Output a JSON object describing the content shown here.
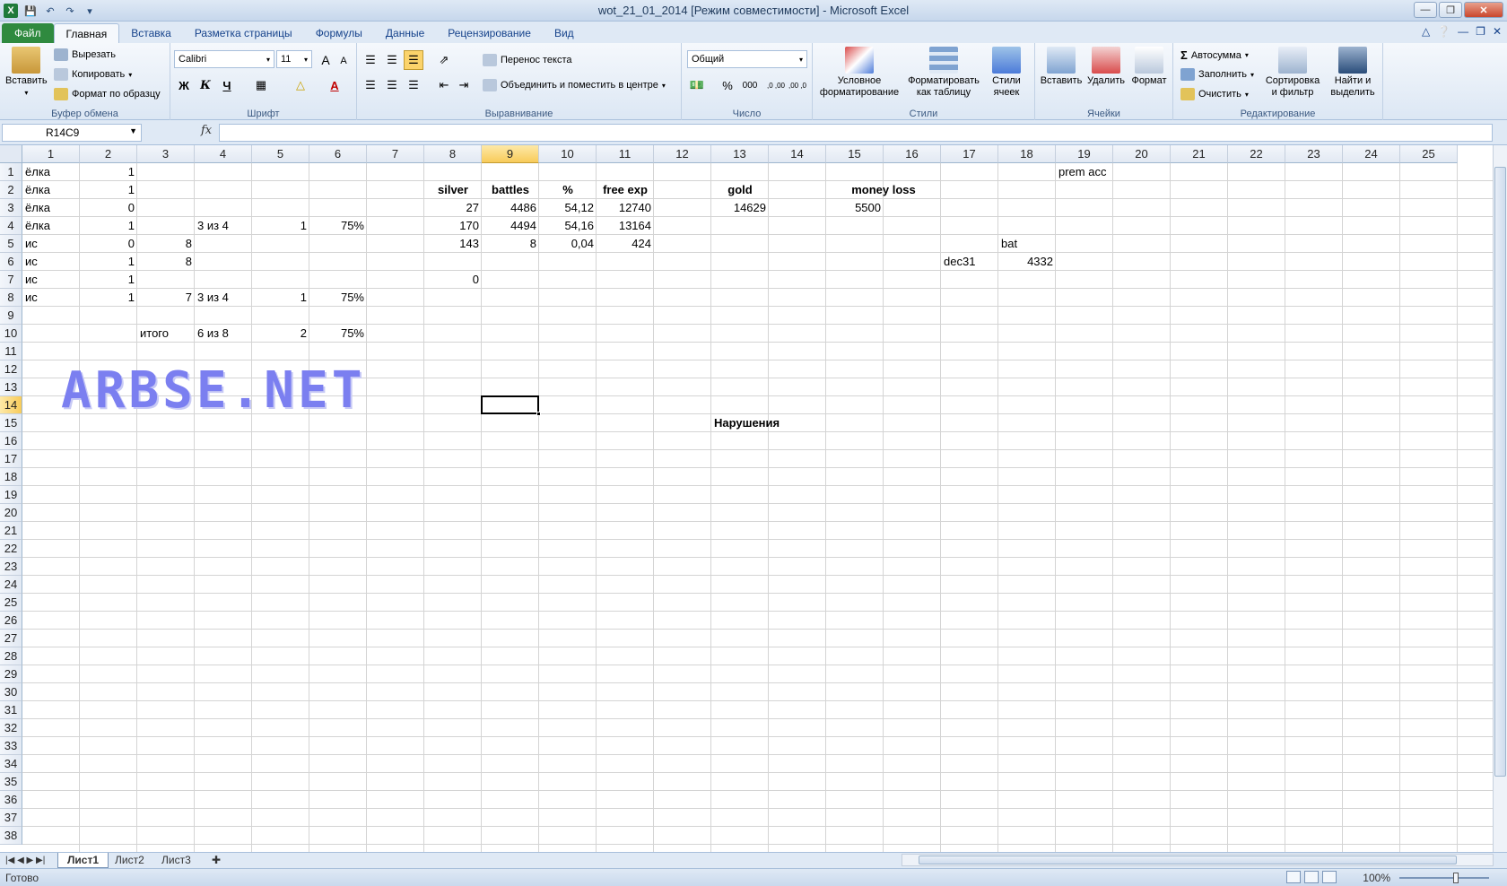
{
  "window": {
    "title": "wot_21_01_2014  [Режим совместимости]  -  Microsoft Excel"
  },
  "tabs": [
    {
      "label": "Файл"
    },
    {
      "label": "Главная"
    },
    {
      "label": "Вставка"
    },
    {
      "label": "Разметка страницы"
    },
    {
      "label": "Формулы"
    },
    {
      "label": "Данные"
    },
    {
      "label": "Рецензирование"
    },
    {
      "label": "Вид"
    }
  ],
  "ribbon": {
    "clipboard": {
      "paste": "Вставить",
      "cut": "Вырезать",
      "copy": "Копировать",
      "format_painter": "Формат по образцу",
      "label": "Буфер обмена"
    },
    "font": {
      "name": "Calibri",
      "size": "11",
      "bold": "Ж",
      "italic": "К",
      "underline": "Ч",
      "grow": "A",
      "shrink": "A",
      "font_color": "A",
      "label": "Шрифт"
    },
    "alignment": {
      "wrap": "Перенос текста",
      "merge": "Объединить и поместить в центре",
      "label": "Выравнивание"
    },
    "number": {
      "format": "Общий",
      "percent": "%",
      "thousands": "000",
      "inc_dec": ",0 ,00",
      "dec_dec": ",00 ,0",
      "label": "Число"
    },
    "styles": {
      "conditional_1": "Условное",
      "conditional_2": "форматирование",
      "as_table_1": "Форматировать",
      "as_table_2": "как таблицу",
      "cell_styles_1": "Стили",
      "cell_styles_2": "ячеек",
      "label": "Стили"
    },
    "cells": {
      "insert": "Вставить",
      "delete": "Удалить",
      "format": "Формат",
      "label": "Ячейки"
    },
    "editing": {
      "autosum": "Автосумма",
      "fill": "Заполнить",
      "clear": "Очистить",
      "sort_1": "Сортировка",
      "sort_2": "и фильтр",
      "find_1": "Найти и",
      "find_2": "выделить",
      "sigma": "Σ",
      "label": "Редактирование"
    }
  },
  "formula_bar": {
    "name_box": "R14C9",
    "fx": "fx",
    "value": ""
  },
  "columns": [
    "1",
    "2",
    "3",
    "4",
    "5",
    "6",
    "7",
    "8",
    "9",
    "10",
    "11",
    "12",
    "13",
    "14",
    "15",
    "16",
    "17",
    "18",
    "19",
    "20",
    "21",
    "22",
    "23",
    "24",
    "25"
  ],
  "rows": [
    "1",
    "2",
    "3",
    "4",
    "5",
    "6",
    "7",
    "8",
    "9",
    "10",
    "11",
    "12",
    "13",
    "14",
    "15",
    "16",
    "17",
    "18",
    "19",
    "20",
    "21",
    "22",
    "23",
    "24",
    "25",
    "26",
    "27",
    "28",
    "29",
    "30",
    "31",
    "32",
    "33",
    "34",
    "35",
    "36",
    "37",
    "38"
  ],
  "selected": {
    "row": 14,
    "col": 9
  },
  "cells": {
    "r1c1": "ёлка",
    "r1c2": "1",
    "r1c19": "prem acc",
    "r2c1": "ёлка",
    "r2c2": "1",
    "r2c8": "silver",
    "r2c9": "battles",
    "r2c10": "%",
    "r2c11": "free exp",
    "r2c13": "gold",
    "r2c15": "money loss",
    "r3c1": "ёлка",
    "r3c2": "0",
    "r3c8": "27",
    "r3c9": "4486",
    "r3c10": "54,12",
    "r3c11": "12740",
    "r3c13": "14629",
    "r3c15": "5500",
    "r4c1": "ёлка",
    "r4c2": "1",
    "r4c4": "3 из 4",
    "r4c5": "1",
    "r4c6": "75%",
    "r4c8": "170",
    "r4c9": "4494",
    "r4c10": "54,16",
    "r4c11": "13164",
    "r5c1": "ис",
    "r5c2": "0",
    "r5c3": "8",
    "r5c8": "143",
    "r5c9": "8",
    "r5c10": "0,04",
    "r5c11": "424",
    "r5c18": "bat",
    "r6c1": "ис",
    "r6c2": "1",
    "r6c3": "8",
    "r6c17": "dec31",
    "r6c18": "4332",
    "r7c1": "ис",
    "r7c2": "1",
    "r7c8": "0",
    "r8c1": "ис",
    "r8c2": "1",
    "r8c3": "7",
    "r8c4": "3 из 4",
    "r8c5": "1",
    "r8c6": "75%",
    "r10c3": "итого",
    "r10c4": "6 из 8",
    "r10c5": "2",
    "r10c6": "75%",
    "r15c13": "Нарушения"
  },
  "watermark": "ARBSE.NET",
  "sheet_tabs": [
    {
      "label": "Лист1"
    },
    {
      "label": "Лист2"
    },
    {
      "label": "Лист3"
    }
  ],
  "status": {
    "text": "Готово",
    "zoom": "100%"
  }
}
